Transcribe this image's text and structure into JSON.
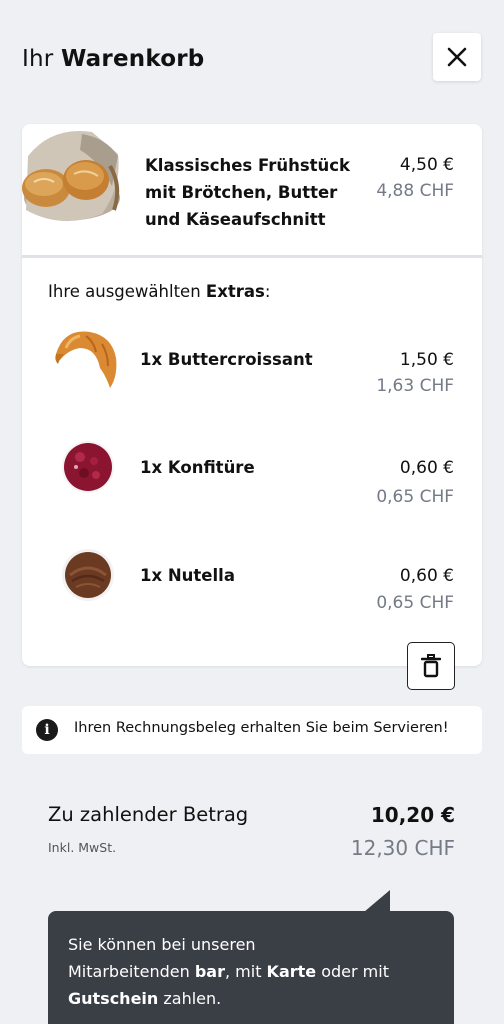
{
  "header": {
    "title_prefix": "Ihr",
    "title_main": "Warenkorb",
    "close_icon": "close-icon"
  },
  "cart": {
    "main_item": {
      "name_line1": "Klassisches Frühstück",
      "name_line2": "mit Brötchen, Butter",
      "name_line3": "und Käseaufschnitt",
      "price_eur": "4,50 €",
      "price_chf": "4,88 CHF",
      "image": "bread-rolls-basket"
    },
    "extras_prefix": "Ihre ausgewählten",
    "extras_bold": "Extras",
    "extras_suffix": ":",
    "extras": [
      {
        "name": "1x Buttercroissant",
        "price_eur": "1,50 €",
        "price_chf": "1,63 CHF",
        "image": "croissant"
      },
      {
        "name": "1x Konfitüre",
        "price_eur": "0,60 €",
        "price_chf": "0,65 CHF",
        "image": "jam"
      },
      {
        "name": "1x Nutella",
        "price_eur": "0,60 €",
        "price_chf": "0,65 CHF",
        "image": "nutella"
      }
    ],
    "delete_icon": "trash-icon"
  },
  "info": {
    "icon": "info-icon",
    "text": "Ihren Rechnungsbeleg erhalten Sie beim Servieren!"
  },
  "total": {
    "label": "Zu zahlender Betrag",
    "sub_label": "Inkl. MwSt.",
    "amount_eur": "10,20 €",
    "amount_chf": "12,30 CHF"
  },
  "tooltip": {
    "part1": "Sie können bei unseren",
    "part2": "Mitarbeitenden ",
    "bold1": "bar",
    "part3": ", mit ",
    "bold2": "Karte",
    "part4": " oder mit",
    "bold3": "Gutschein",
    "part5": " zahlen."
  }
}
